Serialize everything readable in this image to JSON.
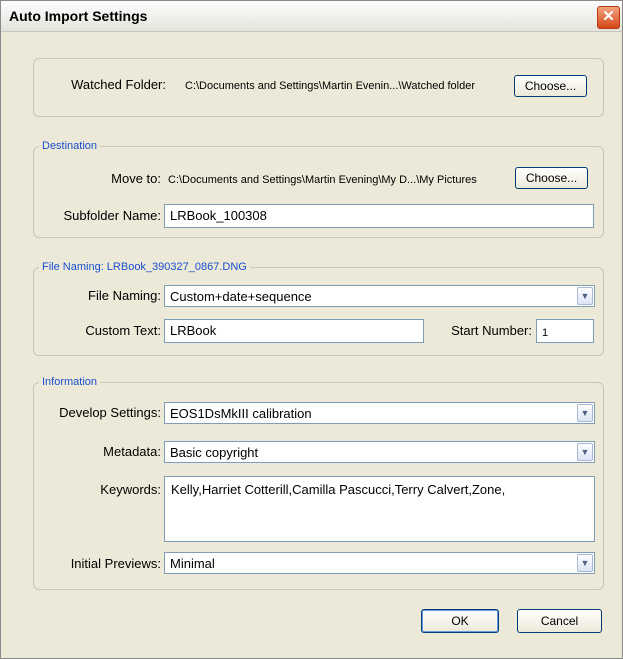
{
  "dialog": {
    "title": "Auto Import Settings",
    "close_glyph": "✕"
  },
  "watched": {
    "label": "Watched Folder:",
    "path": "C:\\Documents and Settings\\Martin Evenin...\\Watched folder",
    "choose_label": "Choose..."
  },
  "destination": {
    "legend": "Destination",
    "move_label": "Move to:",
    "move_path": "C:\\Documents and Settings\\Martin Evening\\My D...\\My Pictures",
    "choose_label": "Choose...",
    "subfolder_label": "Subfolder Name:",
    "subfolder_value": "LRBook_100308"
  },
  "file_naming": {
    "legend": "File Naming: LRBook_390327_0867.DNG",
    "naming_label": "File Naming:",
    "naming_value": "Custom+date+sequence",
    "custom_label": "Custom Text:",
    "custom_value": "LRBook",
    "start_label": "Start Number:",
    "start_value": "1"
  },
  "information": {
    "legend": "Information",
    "develop_label": "Develop Settings:",
    "develop_value": "EOS1DsMkIII calibration",
    "metadata_label": "Metadata:",
    "metadata_value": "Basic copyright",
    "keywords_label": "Keywords:",
    "keywords_value": "Kelly,Harriet Cotterill,Camilla Pascucci,Terry Calvert,Zone,",
    "previews_label": "Initial Previews:",
    "previews_value": "Minimal"
  },
  "footer": {
    "ok_label": "OK",
    "cancel_label": "Cancel"
  },
  "icons": {
    "dropdown": "chevron-down-icon",
    "close": "close-icon"
  },
  "colors": {
    "legend": "#1a4fcf",
    "close": "#d8461a",
    "background": "#ece9d8"
  }
}
